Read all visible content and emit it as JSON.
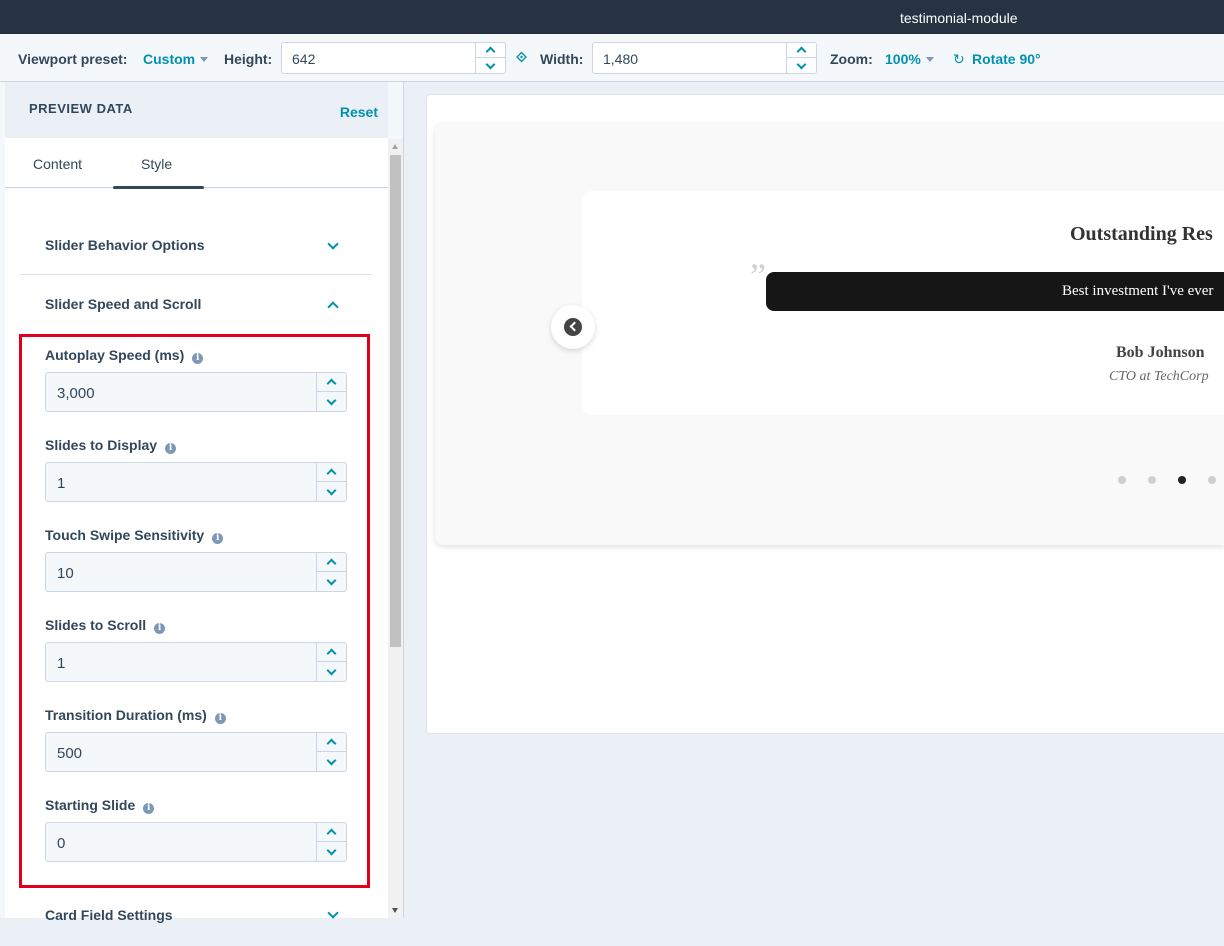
{
  "window": {
    "title": "testimonial-module"
  },
  "toolbar": {
    "viewport_label": "Viewport preset:",
    "viewport_value": "Custom",
    "height_label": "Height:",
    "height_value": "642",
    "width_label": "Width:",
    "width_value": "1,480",
    "zoom_label": "Zoom:",
    "zoom_value": "100%",
    "rotate_label": "Rotate 90°"
  },
  "panel": {
    "title": "PREVIEW DATA",
    "reset_label": "Reset",
    "tabs": [
      {
        "label": "Content",
        "active": false
      },
      {
        "label": "Style",
        "active": true
      }
    ],
    "sections": [
      {
        "title": "Slider Behavior Options",
        "expanded": false
      },
      {
        "title": "Slider Speed and Scroll",
        "expanded": true
      },
      {
        "title": "Card Field Settings",
        "expanded": false
      }
    ],
    "fields": [
      {
        "label": "Autoplay Speed (ms)",
        "value": "3,000"
      },
      {
        "label": "Slides to Display",
        "value": "1"
      },
      {
        "label": "Touch Swipe Sensitivity",
        "value": "10"
      },
      {
        "label": "Slides to Scroll",
        "value": "1"
      },
      {
        "label": "Transition Duration (ms)",
        "value": "500"
      },
      {
        "label": "Starting Slide",
        "value": "0"
      }
    ]
  },
  "preview": {
    "heading": "Outstanding Res",
    "quote_mark": "”",
    "quote": "Best investment I've ever",
    "author": "Bob Johnson",
    "role": "CTO at TechCorp",
    "dots_total": 4,
    "dots_active_index": 2
  },
  "colors": {
    "accent": "#0091ae",
    "titlebar": "#253342",
    "highlight": "#e0001b"
  }
}
